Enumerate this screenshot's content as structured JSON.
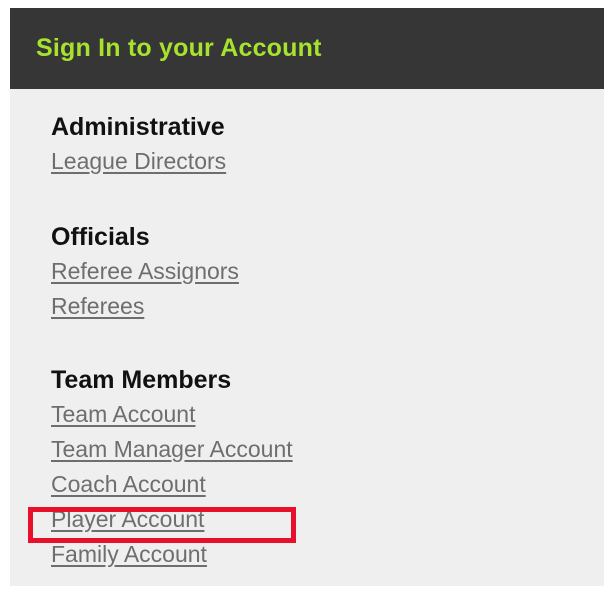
{
  "header": {
    "title": "Sign In to your Account",
    "title_color": "#a6e22e",
    "background": "#363636"
  },
  "sections": [
    {
      "heading": "Administrative",
      "links": [
        "League Directors"
      ]
    },
    {
      "heading": "Officials",
      "links": [
        "Referee Assignors",
        "Referees"
      ]
    },
    {
      "heading": "Team Members",
      "links": [
        "Team Account",
        "Team Manager Account",
        "Coach Account",
        "Player Account",
        "Family Account"
      ]
    }
  ],
  "highlight": {
    "target": "Player Account",
    "color": "#e8112b"
  }
}
